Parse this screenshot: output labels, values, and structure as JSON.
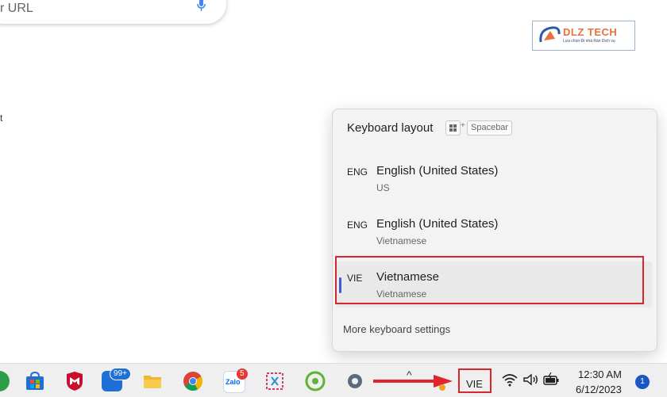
{
  "browser": {
    "search_placeholder": "r URL",
    "stray_text": "t"
  },
  "logo": {
    "text": "DLZ TECH",
    "subtitle": "Lựa chọn Đi nhà Ràn Dich vụ"
  },
  "flyout": {
    "title": "Keyboard layout",
    "shortcut_win": "⊞",
    "shortcut_plus": "+",
    "shortcut_key": "Spacebar",
    "items": [
      {
        "code": "ENG",
        "name": "English (United States)",
        "sub": "US"
      },
      {
        "code": "ENG",
        "name": "English (United States)",
        "sub": "Vietnamese"
      },
      {
        "code": "VIE",
        "name": "Vietnamese",
        "sub": "Vietnamese"
      }
    ],
    "selected_index": 2,
    "more_link": "More keyboard settings"
  },
  "taskbar": {
    "badge_99": "99+",
    "badge_zalo": "5",
    "zalo_label": "Zalo",
    "language": "VIE",
    "chevron": "^",
    "time": "12:30 AM",
    "date": "6/12/2023",
    "notifications": "1"
  },
  "colors": {
    "accent": "#3b5bdb",
    "highlight": "#d6262f"
  }
}
